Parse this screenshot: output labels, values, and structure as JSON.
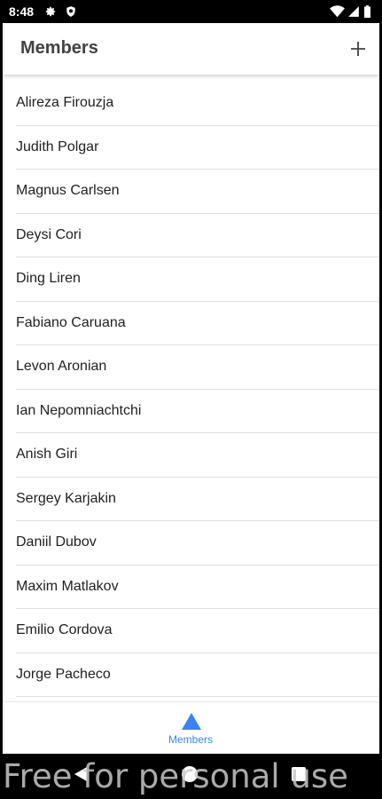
{
  "status_bar": {
    "time": "8:48",
    "icons": [
      "gear-icon",
      "shield-icon",
      "wifi-icon",
      "signal-icon",
      "battery-icon"
    ]
  },
  "app_bar": {
    "title": "Members",
    "add_icon": "plus-icon"
  },
  "members": [
    "Alireza Firouzja",
    "Judith Polgar",
    "Magnus Carlsen",
    "Deysi Cori",
    "Ding Liren",
    "Fabiano Caruana",
    "Levon Aronian",
    "Ian Nepomniachtchi",
    "Anish Giri",
    "Sergey Karjakin",
    "Daniil Dubov",
    "Maxim Matlakov",
    "Emilio Cordova",
    "Jorge Pacheco"
  ],
  "bottom_nav": {
    "members_label": "Members",
    "members_icon": "triangle-icon",
    "active_color": "#3b82f6"
  },
  "system_nav": {
    "icons": [
      "back-icon",
      "home-icon",
      "recents-icon"
    ]
  },
  "watermark": "Free for personal use"
}
